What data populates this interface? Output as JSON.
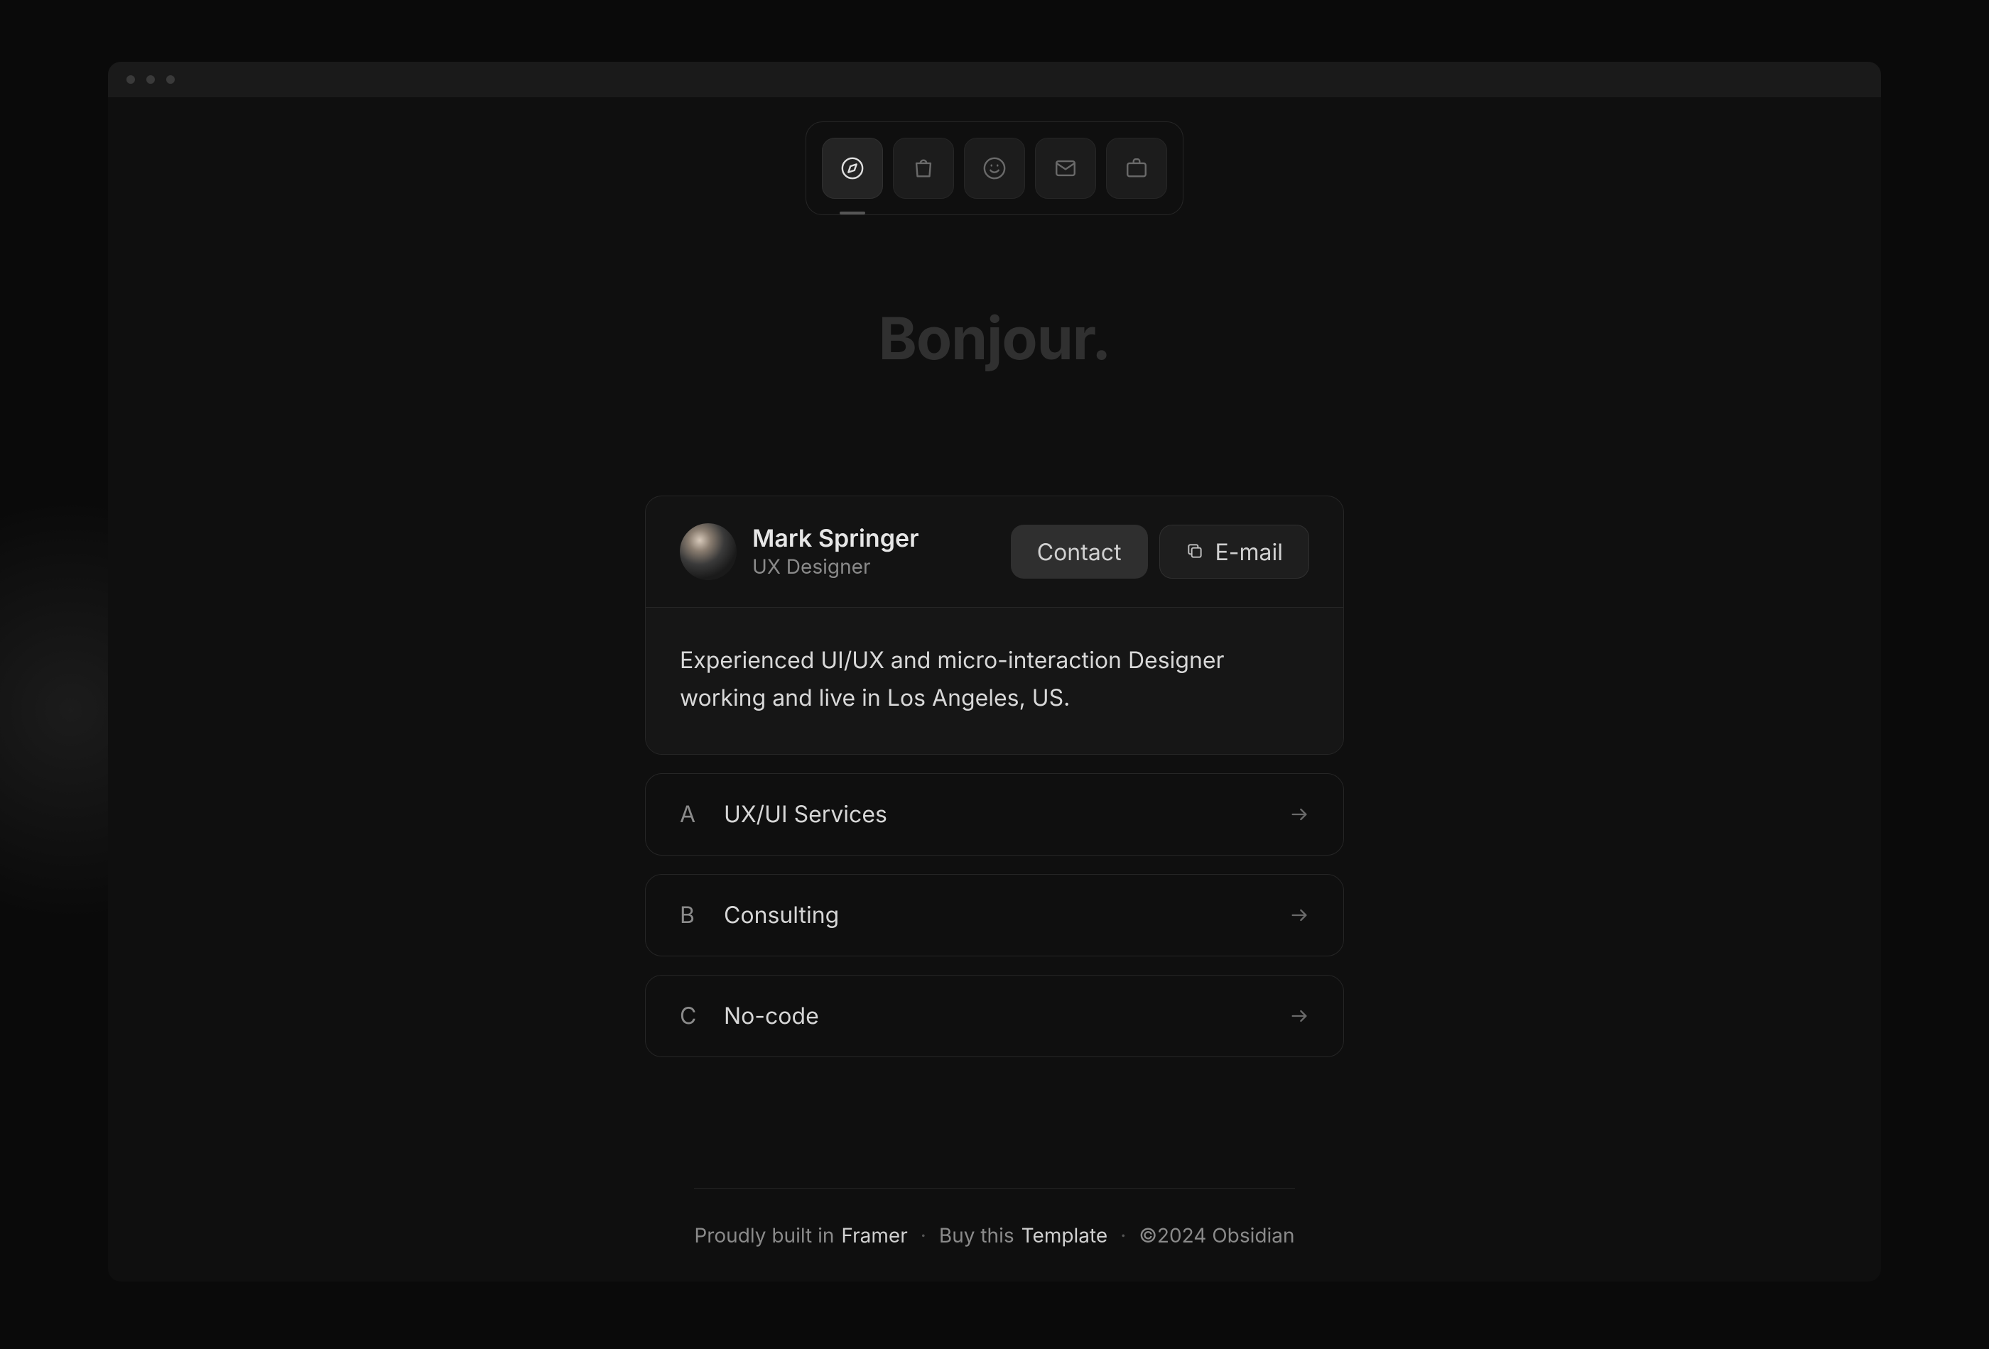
{
  "greeting": "Bonjour.",
  "profile": {
    "name": "Mark Springer",
    "role": "UX Designer",
    "bio": "Experienced UI/UX and micro-interaction Designer working and live in Los Angeles, US.",
    "contact_label": "Contact",
    "email_label": "E-mail"
  },
  "nav": {
    "items": [
      "compass",
      "shop",
      "smile",
      "mail",
      "briefcase"
    ],
    "active_index": 0
  },
  "list": [
    {
      "letter": "A",
      "label": "UX/UI Services"
    },
    {
      "letter": "B",
      "label": "Consulting"
    },
    {
      "letter": "C",
      "label": "No-code"
    }
  ],
  "footer": {
    "built_prefix": "Proudly built in ",
    "built_brand": "Framer",
    "buy_prefix": "Buy this ",
    "buy_strong": "Template",
    "copyright": "©2024 Obsidian"
  }
}
